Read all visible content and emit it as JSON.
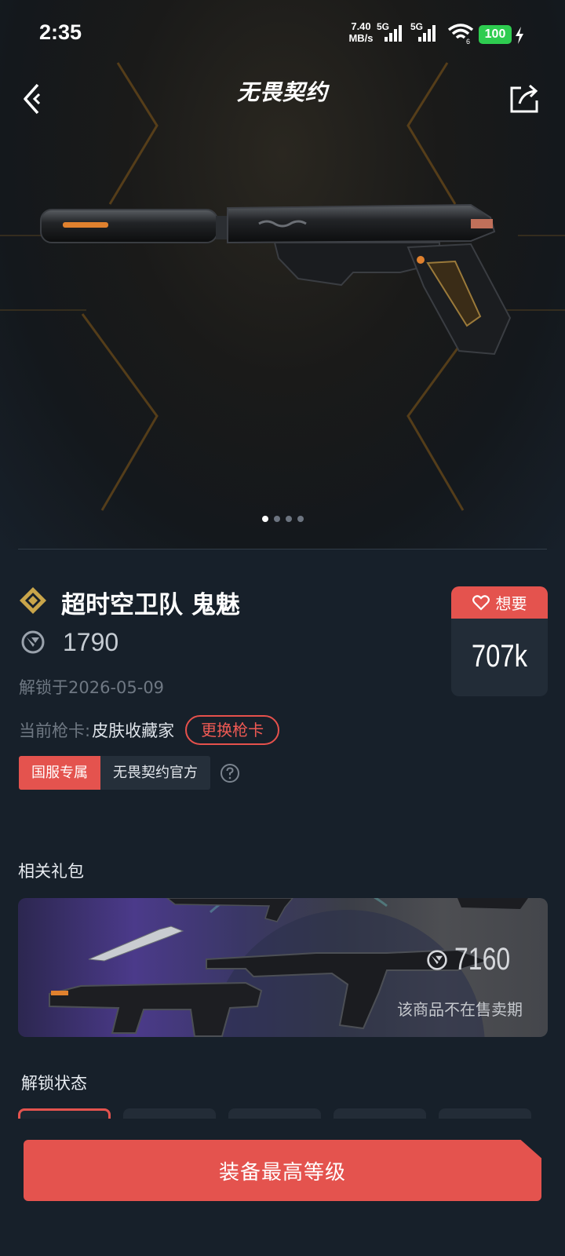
{
  "status_bar": {
    "time": "2:35",
    "net_speed_value": "7.40",
    "net_speed_unit": "MB/s",
    "sim1": "5G",
    "sim2": "5G",
    "wifi_badge": "6",
    "battery": "100"
  },
  "header": {
    "title": "无畏契约",
    "back_icon": "back-arrow-icon",
    "share_icon": "share-icon"
  },
  "carousel": {
    "total": 4,
    "active": 0
  },
  "item": {
    "name": "超时空卫队 鬼魅",
    "price": "1790",
    "unlock_date": "解锁于2026-05-09",
    "card_label": "当前枪卡:",
    "card_value": "皮肤收藏家",
    "change_card": "更换枪卡",
    "tag_exclusive": "国服专属",
    "tag_official": "无畏契约官方"
  },
  "want": {
    "label": "想要",
    "count": "707k"
  },
  "bundle": {
    "section_title": "相关礼包",
    "price": "7160",
    "note": "该商品不在售卖期"
  },
  "unlock_status": {
    "section_title": "解锁状态"
  },
  "action": {
    "equip_label": "装备最高等级"
  },
  "colors": {
    "accent": "#e4534e",
    "background": "#17202a",
    "gold": "#c9a54a"
  }
}
